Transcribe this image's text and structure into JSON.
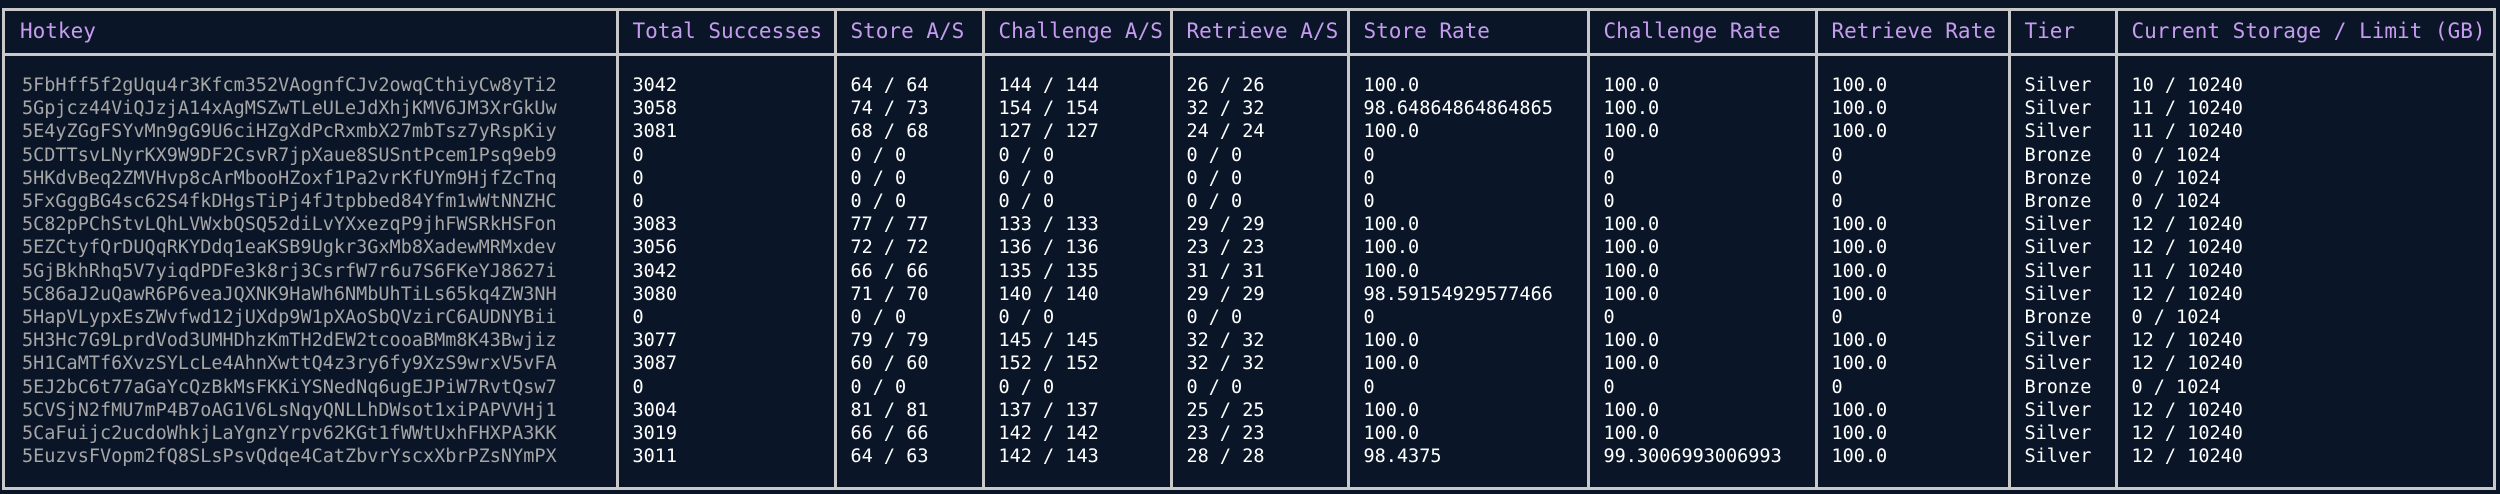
{
  "columns": [
    "Hotkey",
    "Total Successes",
    "Store A/S",
    "Challenge A/S",
    "Retrieve A/S",
    "Store Rate",
    "Challenge Rate",
    "Retrieve Rate",
    "Tier",
    "Current Storage / Limit (GB)"
  ],
  "rows": [
    [
      "5FbHff5f2gUqu4r3Kfcm352VAognfCJv2owqCthiyCw8yTi2",
      "3042",
      "64 / 64",
      "144 / 144",
      "26 / 26",
      "100.0",
      "100.0",
      "100.0",
      "Silver",
      "10 / 10240"
    ],
    [
      "5Gpjcz44ViQJzjA14xAgMSZwTLeULeJdXhjKMV6JM3XrGkUw",
      "3058",
      "74 / 73",
      "154 / 154",
      "32 / 32",
      "98.64864864864865",
      "100.0",
      "100.0",
      "Silver",
      "11 / 10240"
    ],
    [
      "5E4yZGgFSYvMn9gG9U6ciHZgXdPcRxmbX27mbTsz7yRspKiy",
      "3081",
      "68 / 68",
      "127 / 127",
      "24 / 24",
      "100.0",
      "100.0",
      "100.0",
      "Silver",
      "11 / 10240"
    ],
    [
      "5CDTTsvLNyrKX9W9DF2CsvR7jpXaue8SUSntPcem1Psq9eb9",
      "0",
      "0 / 0",
      "0 / 0",
      "0 / 0",
      "0",
      "0",
      "0",
      "Bronze",
      "0 / 1024"
    ],
    [
      "5HKdvBeq2ZMVHvp8cArMbooHZoxf1Pa2vrKfUYm9HjfZcTnq",
      "0",
      "0 / 0",
      "0 / 0",
      "0 / 0",
      "0",
      "0",
      "0",
      "Bronze",
      "0 / 1024"
    ],
    [
      "5FxGggBG4sc62S4fkDHgsTiPj4fJtpbbed84Yfm1wWtNNZHC",
      "0",
      "0 / 0",
      "0 / 0",
      "0 / 0",
      "0",
      "0",
      "0",
      "Bronze",
      "0 / 1024"
    ],
    [
      "5C82pPChStvLQhLVWxbQSQ52diLvYXxezqP9jhFWSRkHSFon",
      "3083",
      "77 / 77",
      "133 / 133",
      "29 / 29",
      "100.0",
      "100.0",
      "100.0",
      "Silver",
      "12 / 10240"
    ],
    [
      "5EZCtyfQrDUQqRKYDdq1eaKSB9Ugkr3GxMb8XadewMRMxdev",
      "3056",
      "72 / 72",
      "136 / 136",
      "23 / 23",
      "100.0",
      "100.0",
      "100.0",
      "Silver",
      "12 / 10240"
    ],
    [
      "5GjBkhRhq5V7yiqdPDFe3k8rj3CsrfW7r6u7S6FKeYJ8627i",
      "3042",
      "66 / 66",
      "135 / 135",
      "31 / 31",
      "100.0",
      "100.0",
      "100.0",
      "Silver",
      "11 / 10240"
    ],
    [
      "5C86aJ2uQawR6P6veaJQXNK9HaWh6NMbUhTiLs65kq4ZW3NH",
      "3080",
      "71 / 70",
      "140 / 140",
      "29 / 29",
      "98.59154929577466",
      "100.0",
      "100.0",
      "Silver",
      "12 / 10240"
    ],
    [
      "5HapVLypxEsZWvfwd12jUXdp9W1pXAoSbQVzirC6AUDNYBii",
      "0",
      "0 / 0",
      "0 / 0",
      "0 / 0",
      "0",
      "0",
      "0",
      "Bronze",
      "0 / 1024"
    ],
    [
      "5H3Hc7G9LprdVod3UMHDhzKmTH2dEW2tcooaBMm8K43Bwjiz",
      "3077",
      "79 / 79",
      "145 / 145",
      "32 / 32",
      "100.0",
      "100.0",
      "100.0",
      "Silver",
      "12 / 10240"
    ],
    [
      "5H1CaMTf6XvzSYLcLe4AhnXwttQ4z3ry6fy9XzS9wrxV5vFA",
      "3087",
      "60 / 60",
      "152 / 152",
      "32 / 32",
      "100.0",
      "100.0",
      "100.0",
      "Silver",
      "12 / 10240"
    ],
    [
      "5EJ2bC6t77aGaYcQzBkMsFKKiYSNedNq6ugEJPiW7RvtQsw7",
      "0",
      "0 / 0",
      "0 / 0",
      "0 / 0",
      "0",
      "0",
      "0",
      "Bronze",
      "0 / 1024"
    ],
    [
      "5CVSjN2fMU7mP4B7oAG1V6LsNqyQNLLhDWsot1xiPAPVVHj1",
      "3004",
      "81 / 81",
      "137 / 137",
      "25 / 25",
      "100.0",
      "100.0",
      "100.0",
      "Silver",
      "12 / 10240"
    ],
    [
      "5CaFuijc2ucdoWhkjLaYgnzYrpv62KGt1fWWtUxhFHXPA3KK",
      "3019",
      "66 / 66",
      "142 / 142",
      "23 / 23",
      "100.0",
      "100.0",
      "100.0",
      "Silver",
      "12 / 10240"
    ],
    [
      "5EuzvsFVopm2fQ8SLsPsvQdqe4CatZbvrYscxXbrPZsNYmPX",
      "3011",
      "64 / 63",
      "142 / 143",
      "28 / 28",
      "98.4375",
      "99.3006993006993",
      "100.0",
      "Silver",
      "12 / 10240"
    ]
  ],
  "colors": {
    "background": "#0a1628",
    "header_text": "#c79cf0",
    "border": "#c9c9c9",
    "hotkey_text": "#a6a6a6",
    "cell_text": "#ffffff"
  }
}
